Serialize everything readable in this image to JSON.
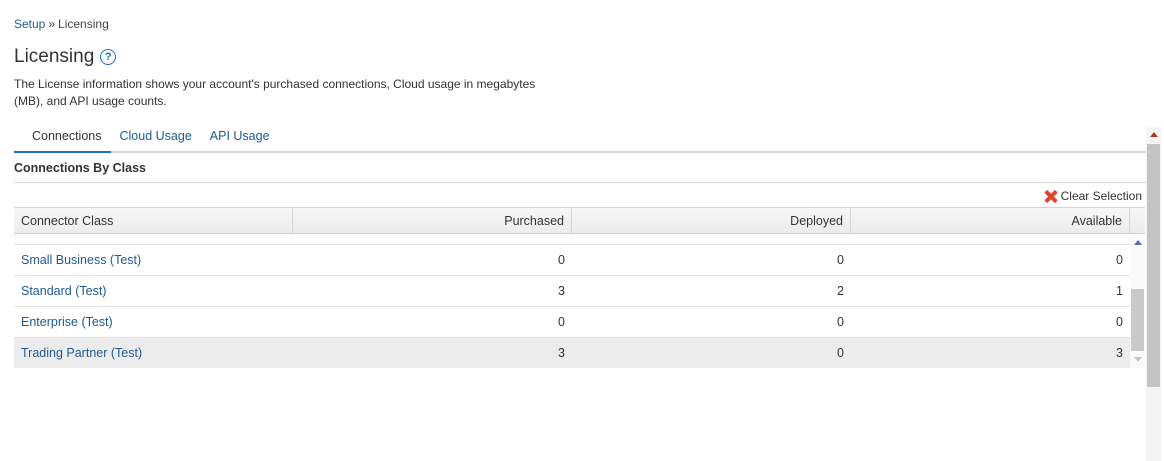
{
  "breadcrumb": {
    "parent": "Setup",
    "separator": "»",
    "current": "Licensing"
  },
  "page": {
    "title": "Licensing",
    "help_glyph": "?",
    "description": "The License information shows your account's purchased connections, Cloud usage in megabytes (MB), and API usage counts."
  },
  "tabs": [
    {
      "label": "Connections",
      "active": true
    },
    {
      "label": "Cloud Usage",
      "active": false
    },
    {
      "label": "API Usage",
      "active": false
    }
  ],
  "section": {
    "title": "Connections By Class"
  },
  "clear_selection": {
    "label": "Clear Selection",
    "icon": "close-x-icon",
    "color": "#e0452b"
  },
  "grid": {
    "columns": [
      "Connector Class",
      "Purchased",
      "Deployed",
      "Available"
    ],
    "rows": [
      {
        "class": "Small Business (Test)",
        "purchased": "0",
        "deployed": "0",
        "available": "0"
      },
      {
        "class": "Standard (Test)",
        "purchased": "3",
        "deployed": "2",
        "available": "1"
      },
      {
        "class": "Enterprise (Test)",
        "purchased": "0",
        "deployed": "0",
        "available": "0"
      },
      {
        "class": "Trading Partner (Test)",
        "purchased": "3",
        "deployed": "0",
        "available": "3"
      }
    ]
  },
  "colors": {
    "link": "#1f5a94",
    "accent": "#1f6fb8",
    "selected_row": "#ececec"
  }
}
